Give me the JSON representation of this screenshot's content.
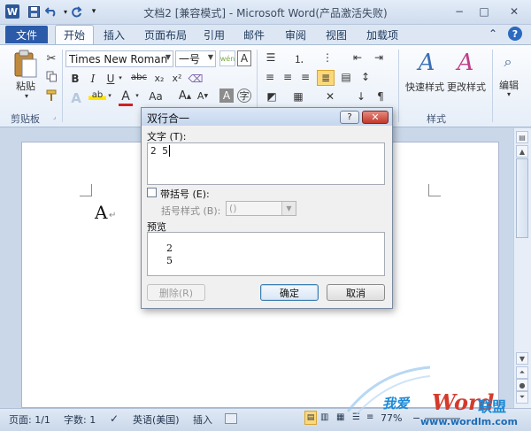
{
  "window": {
    "title": "文档2 [兼容模式] - Microsoft Word(产品激活失败)",
    "app_icon": "W",
    "minimize": "−",
    "restore": "□",
    "close": "✕"
  },
  "quick_access": {
    "save_icon": "save-icon",
    "undo_icon": "undo-icon",
    "redo_icon": "redo-icon",
    "customize": "▾"
  },
  "tabs": {
    "file": "文件",
    "items": [
      "开始",
      "插入",
      "页面布局",
      "引用",
      "邮件",
      "审阅",
      "视图",
      "加载项"
    ]
  },
  "ribbon": {
    "clipboard": {
      "paste": "粘贴",
      "label": "剪贴板"
    },
    "font": {
      "name": "Times New Roman",
      "size": "一号",
      "bold": "B",
      "italic": "I",
      "underline": "U",
      "strike": "abc",
      "subscript": "x₂",
      "superscript": "x²"
    },
    "styles": {
      "quick": "快速样式",
      "change": "更改样式",
      "label": "样式"
    },
    "editing": {
      "label": "编辑"
    }
  },
  "document": {
    "char": "A",
    "para_mark": "↵"
  },
  "status": {
    "page": "页面: 1/1",
    "words": "字数: 1",
    "language": "英语(美国)",
    "insert": "插入",
    "zoom": "77%"
  },
  "watermark": {
    "text1": "我爱",
    "brand": "Word",
    "sub": "联盟",
    "url": "www.wordlm.com"
  },
  "dialog": {
    "title": "双行合一",
    "help": "?",
    "close": "✕",
    "text_label": "文字 (T):",
    "text_value": "2 5",
    "bracket_label": "带括号 (E):",
    "bracket_style_label": "括号样式 (B):",
    "bracket_style_value": "()",
    "preview_label": "预览",
    "preview_line1": "2",
    "preview_line2": "5",
    "delete": "删除(R)",
    "ok": "确定",
    "cancel": "取消"
  }
}
